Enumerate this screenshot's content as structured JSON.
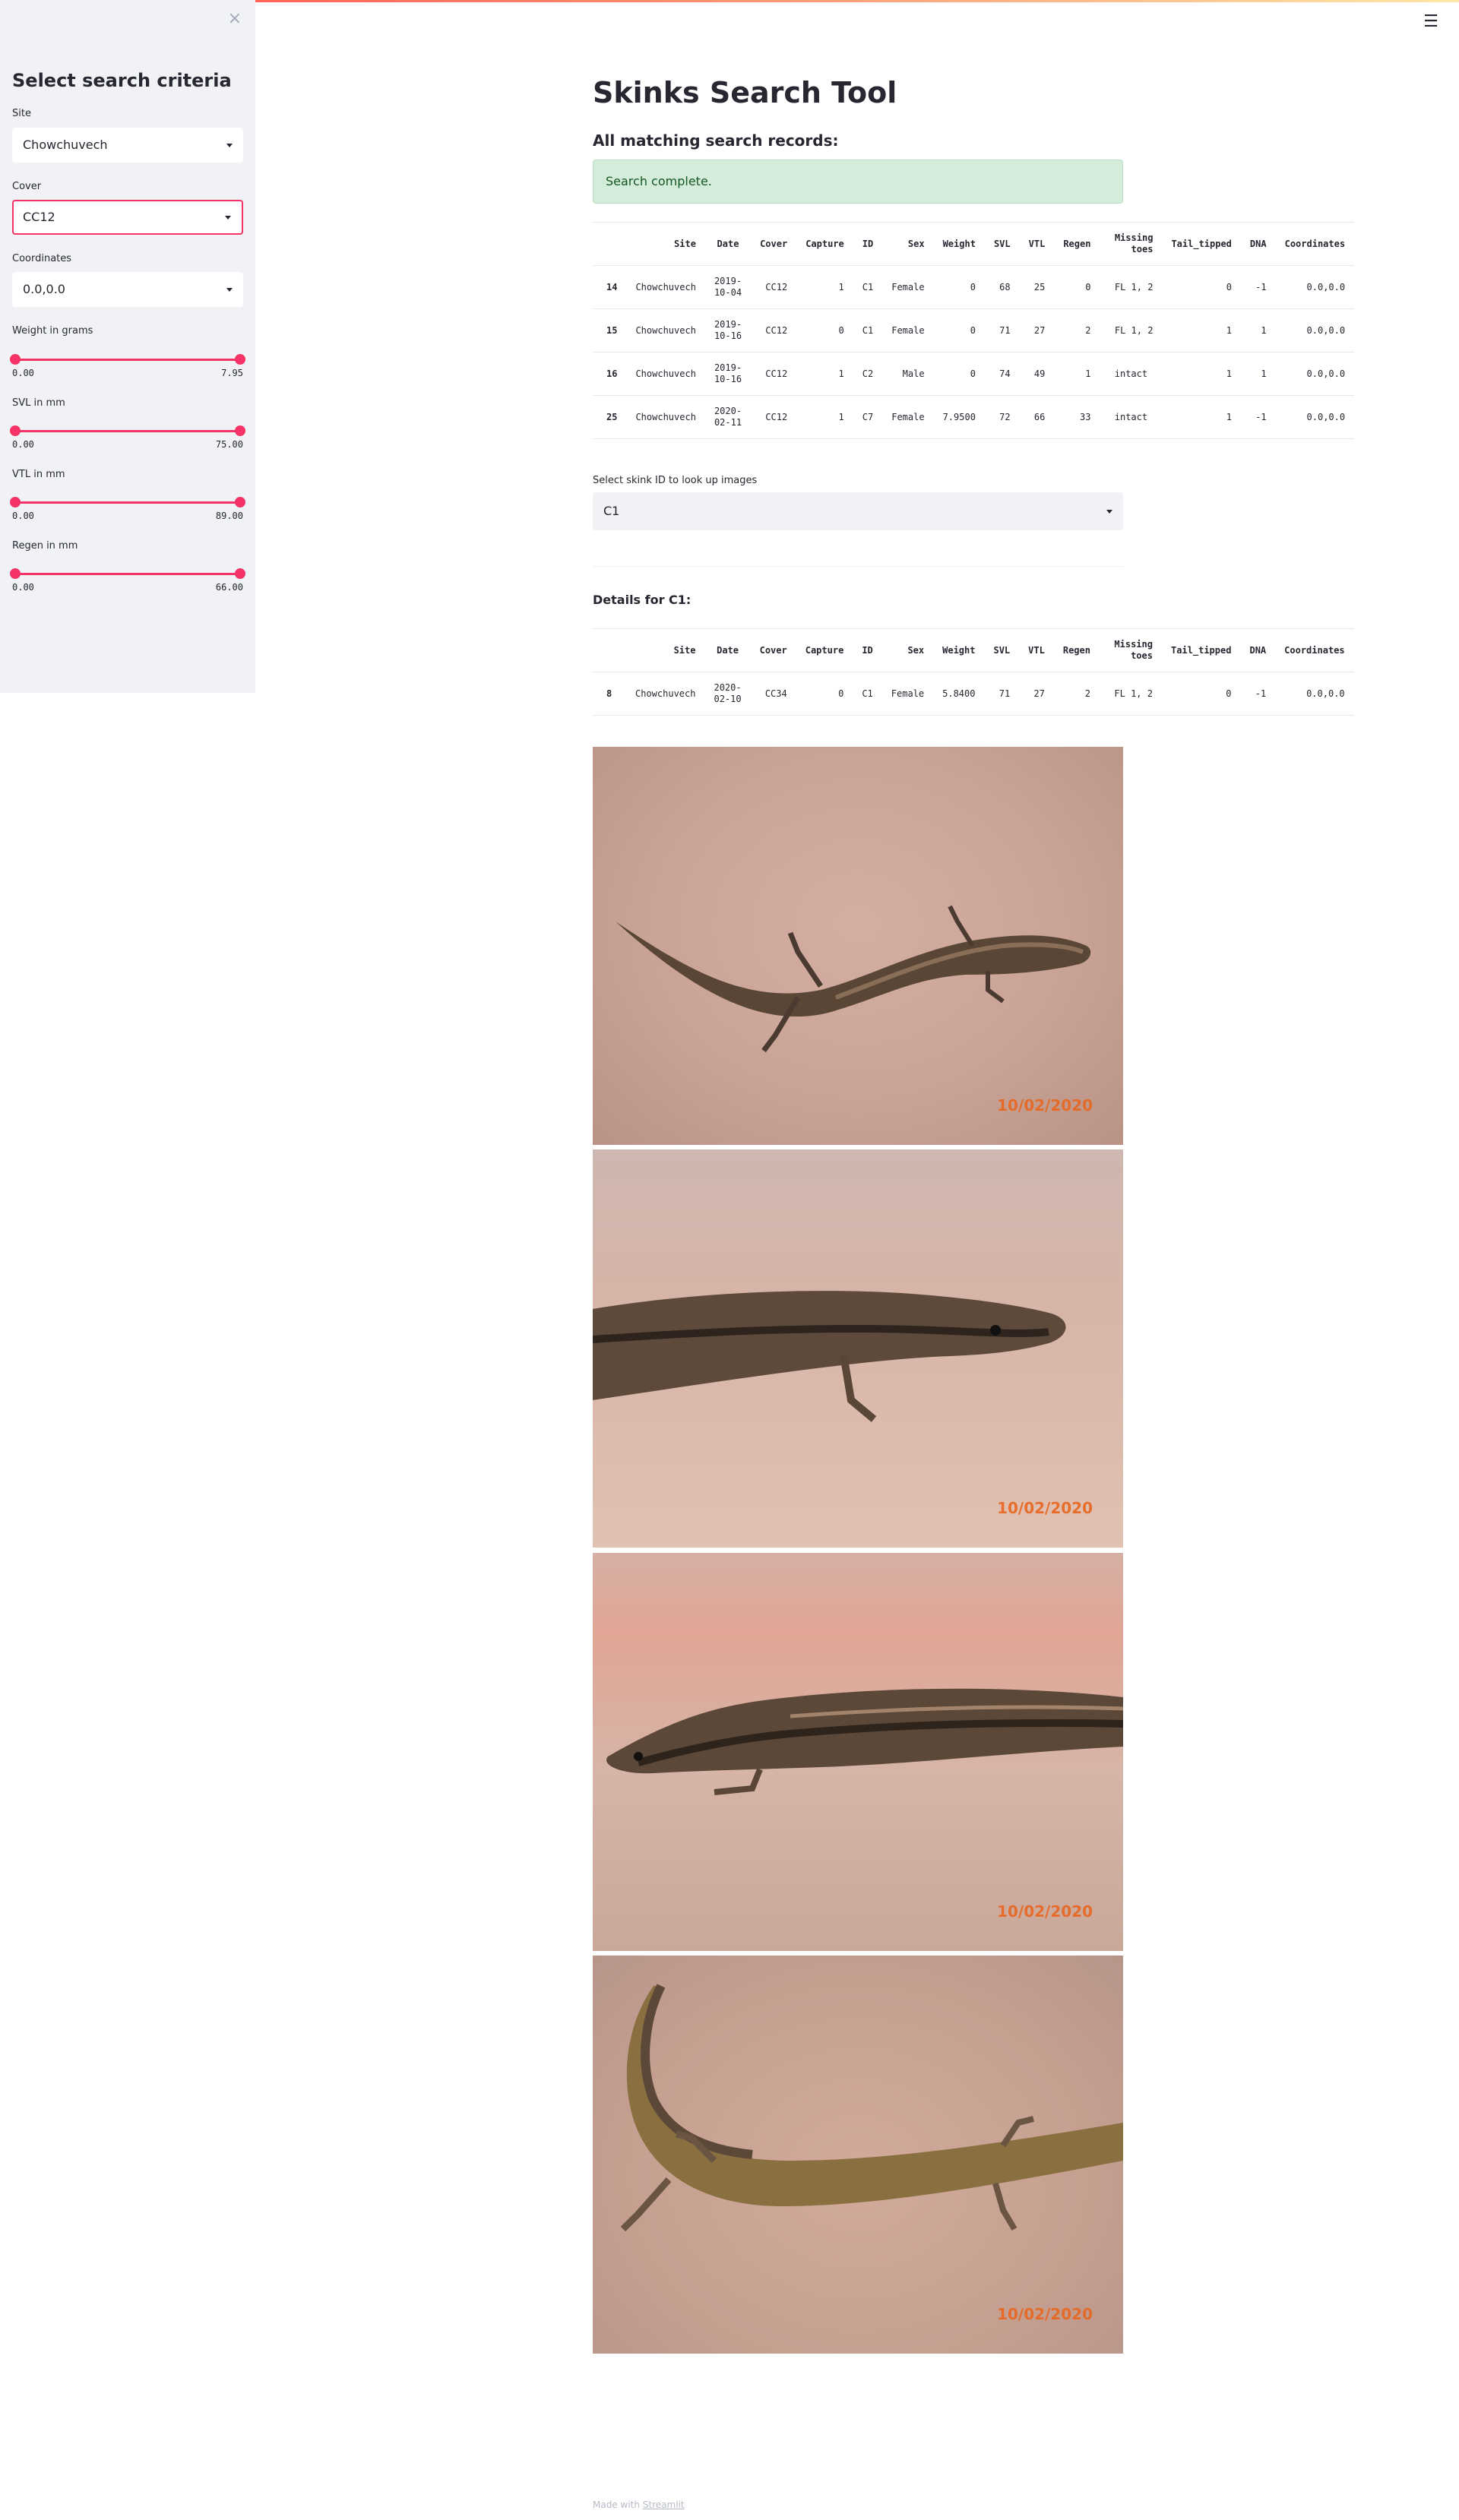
{
  "sidebar": {
    "close_glyph": "×",
    "title": "Select search criteria",
    "site": {
      "label": "Site",
      "value": "Chowchuvech"
    },
    "cover": {
      "label": "Cover",
      "value": "CC12"
    },
    "coordinates": {
      "label": "Coordinates",
      "value": "0.0,0.0"
    },
    "sliders": [
      {
        "label": "Weight in grams",
        "min": "0.00",
        "max": "7.95"
      },
      {
        "label": "SVL in mm",
        "min": "0.00",
        "max": "75.00"
      },
      {
        "label": "VTL in mm",
        "min": "0.00",
        "max": "89.00"
      },
      {
        "label": "Regen in mm",
        "min": "0.00",
        "max": "66.00"
      }
    ]
  },
  "menu_glyph": "☰",
  "main": {
    "title": "Skinks Search Tool",
    "matching_heading": "All matching search records:",
    "status": "Search complete.",
    "columns": [
      "Site",
      "Date",
      "Cover",
      "Capture",
      "ID",
      "Sex",
      "Weight",
      "SVL",
      "VTL",
      "Regen",
      "Missing toes",
      "Tail_tipped",
      "DNA",
      "Coordinates"
    ],
    "records": [
      {
        "idx": "14",
        "site": "Chowchuvech",
        "date": "2019-10-04",
        "cover": "CC12",
        "capture": "1",
        "id": "C1",
        "sex": "Female",
        "weight": "0",
        "svl": "68",
        "vtl": "25",
        "regen": "0",
        "toes": "FL 1, 2",
        "tail": "0",
        "dna": "-1",
        "coords": "0.0,0.0"
      },
      {
        "idx": "15",
        "site": "Chowchuvech",
        "date": "2019-10-16",
        "cover": "CC12",
        "capture": "0",
        "id": "C1",
        "sex": "Female",
        "weight": "0",
        "svl": "71",
        "vtl": "27",
        "regen": "2",
        "toes": "FL 1, 2",
        "tail": "1",
        "dna": "1",
        "coords": "0.0,0.0"
      },
      {
        "idx": "16",
        "site": "Chowchuvech",
        "date": "2019-10-16",
        "cover": "CC12",
        "capture": "1",
        "id": "C2",
        "sex": "Male",
        "weight": "0",
        "svl": "74",
        "vtl": "49",
        "regen": "1",
        "toes": "intact",
        "tail": "1",
        "dna": "1",
        "coords": "0.0,0.0"
      },
      {
        "idx": "25",
        "site": "Chowchuvech",
        "date": "2020-02-11",
        "cover": "CC12",
        "capture": "1",
        "id": "C7",
        "sex": "Female",
        "weight": "7.9500",
        "svl": "72",
        "vtl": "66",
        "regen": "33",
        "toes": "intact",
        "tail": "1",
        "dna": "-1",
        "coords": "0.0,0.0"
      }
    ],
    "lookup": {
      "label": "Select skink ID to look up images",
      "value": "C1"
    },
    "details_heading": "Details for C1:",
    "details": [
      {
        "idx": "8",
        "site": "Chowchuvech",
        "date": "2020-02-10",
        "cover": "CC34",
        "capture": "0",
        "id": "C1",
        "sex": "Female",
        "weight": "5.8400",
        "svl": "71",
        "vtl": "27",
        "regen": "2",
        "toes": "FL 1, 2",
        "tail": "0",
        "dna": "-1",
        "coords": "0.0,0.0"
      }
    ],
    "photo_dates": [
      "10/02/2020",
      "10/02/2020",
      "10/02/2020",
      "10/02/2020"
    ]
  },
  "footer": {
    "prefix": "Made with",
    "link": "Streamlit"
  },
  "colors": {
    "accent": "#f63366",
    "sidebar_bg": "#f0f2f6",
    "success_bg": "#d4edda",
    "success_text": "#155724"
  }
}
